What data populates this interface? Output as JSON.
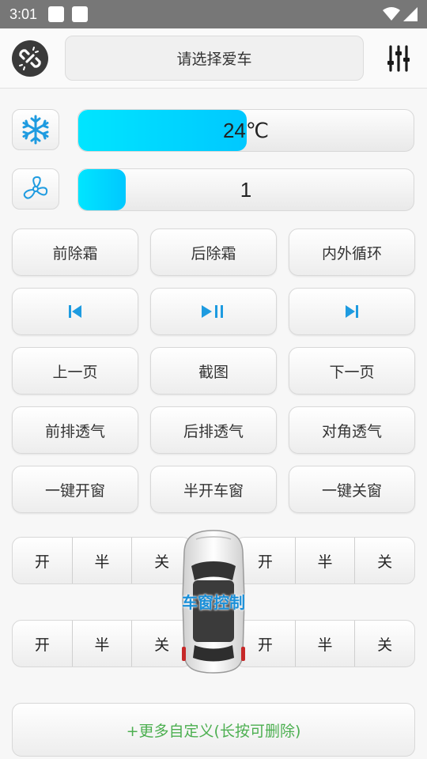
{
  "status_bar": {
    "time": "3:01"
  },
  "header": {
    "car_select_label": "请选择爱车"
  },
  "climate": {
    "temperature": {
      "label": "24℃",
      "level": 0.5
    },
    "fan": {
      "label": "1",
      "level": 0.14
    }
  },
  "buttons": {
    "row1": [
      "前除霜",
      "后除霜",
      "内外循环"
    ],
    "row3": [
      "上一页",
      "截图",
      "下一页"
    ],
    "row4": [
      "前排透气",
      "后排透气",
      "对角透气"
    ],
    "row5": [
      "一键开窗",
      "半开车窗",
      "一键关窗"
    ]
  },
  "media": {
    "prev_icon": "skip-previous-icon",
    "play_pause_icon": "play-pause-icon",
    "next_icon": "skip-next-icon",
    "color": "#1e9be0"
  },
  "window_control": {
    "title": "车窗控制",
    "options": [
      "开",
      "半",
      "关"
    ]
  },
  "more_button": {
    "label": "+更多自定义(长按可删除)"
  },
  "colors": {
    "accent_cyan": "#00e5ff",
    "green_text": "#4caf50",
    "title_blue": "#1a8fd8",
    "status_bar": "#777777"
  }
}
